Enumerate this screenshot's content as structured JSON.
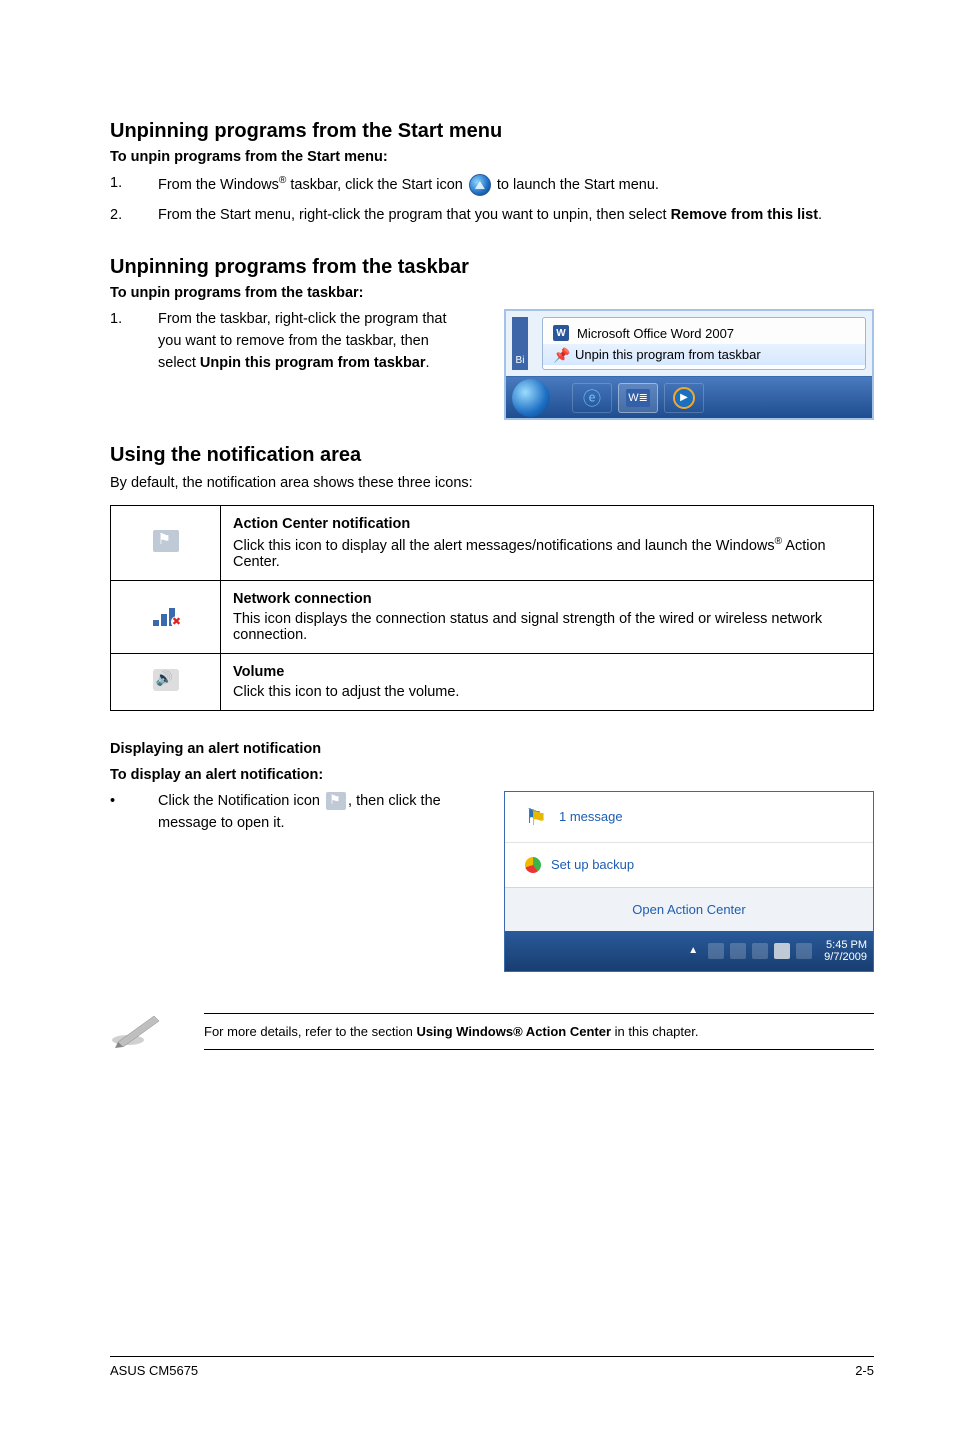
{
  "section1": {
    "heading": "Unpinning programs from the Start menu",
    "subheading": "To unpin programs from the Start menu:",
    "step1_num": "1.",
    "step1_a": "From the Windows",
    "step1_b": " taskbar, click the Start icon ",
    "step1_c": " to launch the Start menu.",
    "step2_num": "2.",
    "step2_a": "From the Start menu, right-click the program that you want to unpin, then select ",
    "step2_bold": "Remove from this list",
    "step2_b": "."
  },
  "section2": {
    "heading": "Unpinning programs from the taskbar",
    "subheading": "To unpin programs from the taskbar:",
    "step1_num": "1.",
    "step1_a": "From the taskbar, right-click the program that you want to remove from the taskbar, then select ",
    "step1_bold": "Unpin this program from taskbar",
    "step1_b": "."
  },
  "jumplist": {
    "item1": "Microsoft Office Word 2007",
    "item2": "Unpin this program from taskbar",
    "bi": "Bi",
    "word_glyph": "W",
    "word_btn": "W≣"
  },
  "section3": {
    "heading": "Using the notification area",
    "intro": "By default, the notification area shows these three icons:"
  },
  "table": {
    "row1_title": "Action Center notification",
    "row1_a": "Click this icon to display all the alert messages/notifications and launch the Windows",
    "row1_b": " Action Center.",
    "row2_title": "Network connection",
    "row2_text": "This icon displays the connection status and signal strength of the wired or wireless network connection.",
    "row3_title": "Volume",
    "row3_text": "Click this icon to adjust the volume."
  },
  "section4": {
    "heading": "Displaying an alert notification",
    "subheading": "To display an alert notification:",
    "bullet": "•",
    "text_a": "Click the Notification icon ",
    "text_b": ", then click the message to open it."
  },
  "alertbox": {
    "header": "1 message",
    "setup": "Set up backup",
    "open": "Open Action Center",
    "time": "5:45 PM",
    "date": "9/7/2009",
    "up": "▲"
  },
  "note": {
    "text_a": "For more details, refer to the section ",
    "text_bold": "Using Windows® Action Center",
    "text_b": " in this chapter."
  },
  "reg": "®",
  "footer": {
    "left": "ASUS CM5675",
    "right": "2-5"
  }
}
